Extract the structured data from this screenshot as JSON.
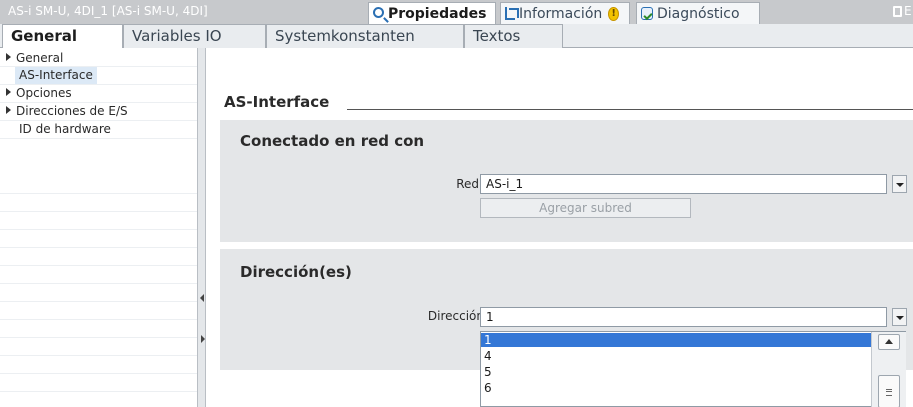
{
  "window": {
    "title": "AS-i SM-U, 4DI_1 [AS-i SM-U, 4DI]",
    "inspector_tabs": [
      {
        "label": "Propiedades",
        "icon": "magnifier-icon",
        "active": true
      },
      {
        "label": "Información",
        "icon": "info-icon",
        "active": false
      },
      {
        "label": "Diagnóstico",
        "icon": "diagnostics-icon",
        "active": false
      }
    ],
    "trailing_text": "E"
  },
  "property_tabs": [
    "General",
    "Variables IO",
    "Systemkonstanten",
    "Textos"
  ],
  "nav": {
    "items": [
      {
        "label": "General",
        "expandable": true,
        "selected": false
      },
      {
        "label": "AS-Interface",
        "expandable": false,
        "selected": true
      },
      {
        "label": "Opciones",
        "expandable": true,
        "selected": false
      },
      {
        "label": "Direcciones de E/S",
        "expandable": true,
        "selected": false
      },
      {
        "label": "ID de hardware",
        "expandable": false,
        "selected": false
      }
    ]
  },
  "content": {
    "section_title": "AS-Interface",
    "network_group": {
      "title": "Conectado en red con",
      "red_label": "Red",
      "red_value": "AS-i_1",
      "add_subnet_label": "Agregar subred"
    },
    "address_group": {
      "title": "Dirección(es)",
      "address_label": "Dirección",
      "address_value": "1",
      "options": [
        "1",
        "4",
        "5",
        "6"
      ],
      "selected_option": "1"
    }
  },
  "colors": {
    "titlebar": "#c7c9cc",
    "group_background": "#e4e6e8",
    "selection": "#3477d6",
    "nav_selected": "#dce9f6"
  }
}
